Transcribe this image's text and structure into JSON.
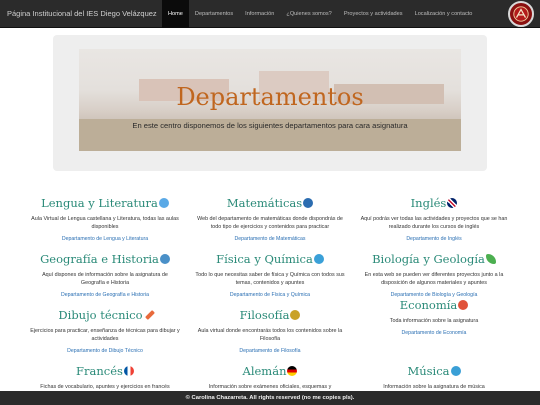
{
  "navbar": {
    "brand": "Página Institucional del IES Diego Velázquez",
    "items": [
      {
        "label": "Home",
        "active": true
      },
      {
        "label": "Departamentos",
        "active": false
      },
      {
        "label": "Información",
        "active": false
      },
      {
        "label": "¿Quienes somos?",
        "active": false
      },
      {
        "label": "Proyectos y actividades",
        "active": false
      },
      {
        "label": "Localización y contacto",
        "active": false
      }
    ]
  },
  "hero": {
    "title": "Departamentos",
    "subtitle": "En este centro disponemos de los siguientes departamentos para cara asignatura"
  },
  "departments": [
    {
      "title": "Lengua y Literatura",
      "icon": "globe-icon",
      "icon_color": "#5aa9e6",
      "desc": "Aula Virtual de Lengua castellana y Literatura, todas las aulas disponibles",
      "link": "Departamento de Lengua y Literatura"
    },
    {
      "title": "Matemáticas",
      "icon": "math-icon",
      "icon_color": "#2b6cb0",
      "desc": "Web del departamento de matemáticas donde dispondrás de todo tipo de ejercicios y contenidos para practicar",
      "link": "Departamento de Matemáticas"
    },
    {
      "title": "Inglés",
      "icon": "uk-flag-icon",
      "icon_color": "#c8102e",
      "desc": "Aquí podrás ver todas las actividades y proyectos que se han realizado durante los cursos de inglés",
      "link": "Departamento de Inglés"
    },
    {
      "title": "Geografía e Historia",
      "icon": "globe-icon",
      "icon_color": "#4a90c8",
      "desc": "Aquí dispones de información sobre la asignatura de Geografía e Historia",
      "link": "Departamento de Geografía e Historia"
    },
    {
      "title": "Física y Química",
      "icon": "atom-icon",
      "icon_color": "#3aa0d8",
      "desc": "Todo lo que necesitas saber de física y Química con todos sus temas, contenidos y apuntes",
      "link": "Departamento de Física y Química"
    },
    {
      "title": "Biología y Geología",
      "icon": "leaf-icon",
      "icon_color": "#4caf50",
      "desc": "En esta web se pueden ver diferentes proyectos junto a la disposición de algunos materiales y apuntes",
      "link": "Departamento de Biología y Geología"
    },
    {
      "title": "Dibujo técnico",
      "icon": "pencil-icon",
      "icon_color": "#e86a3c",
      "desc": "Ejercicios para practicar, enseñanza de técnicas para dibujar y actividades",
      "link": "Departamento de Dibujo Técnico"
    },
    {
      "title": "Filosofía",
      "icon": "thinker-icon",
      "icon_color": "#c9a227",
      "desc": "Aula virtual donde encontrarás todos los contenidos sobre la Filosofía",
      "link": "Departamento de Filosofía"
    },
    {
      "title": "Economía",
      "icon": "coin-icon",
      "icon_color": "#e0523a",
      "desc": "Toda información sobre la asignatura",
      "link": "Departamento de Economía"
    },
    {
      "title": "Francés",
      "icon": "france-flag-icon",
      "icon_color": "#0055a4",
      "desc": "Fichas de vocabulario, apuntes y ejercicios en francés",
      "link": ""
    },
    {
      "title": "Alemán",
      "icon": "germany-flag-icon",
      "icon_color": "#dd0000",
      "desc": "Información sobre exámenes oficiales, esquemas y contenidos en alemán",
      "link": ""
    },
    {
      "title": "Música",
      "icon": "music-icon",
      "icon_color": "#3a9fd6",
      "desc": "Información sobre la asignatura de música",
      "link": ""
    }
  ],
  "footer": {
    "text": "© Carolina Chazarreta. All rights reserved (no me copies pls)."
  }
}
